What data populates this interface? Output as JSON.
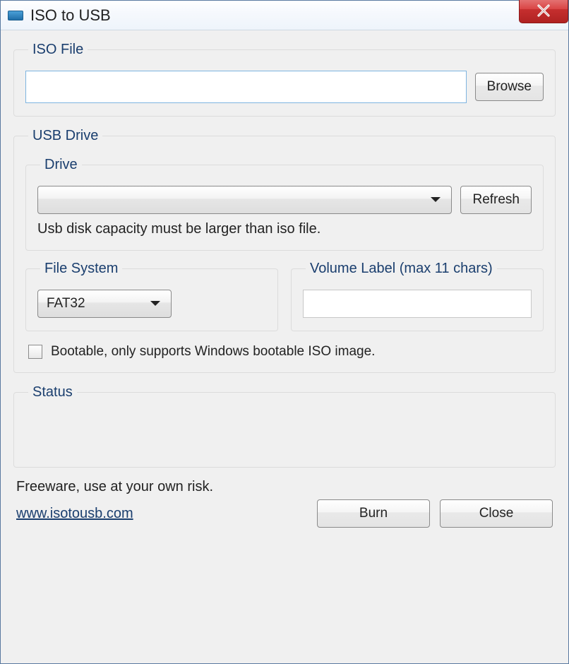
{
  "window": {
    "title": "ISO to USB"
  },
  "iso": {
    "legend": "ISO File",
    "path": "",
    "browse": "Browse"
  },
  "usb": {
    "legend": "USB Drive",
    "drive": {
      "legend": "Drive",
      "selected": "",
      "refresh": "Refresh",
      "hint": "Usb disk capacity must be larger than iso file."
    },
    "filesystem": {
      "legend": "File System",
      "selected": "FAT32"
    },
    "volume": {
      "legend": "Volume Label (max 11 chars)",
      "value": ""
    },
    "bootable": {
      "checked": false,
      "label": "Bootable, only supports Windows bootable ISO image."
    }
  },
  "status": {
    "legend": "Status",
    "text": ""
  },
  "footer": {
    "disclaimer": "Freeware, use at your own risk.",
    "url": "www.isotousb.com",
    "burn": "Burn",
    "close": "Close"
  }
}
